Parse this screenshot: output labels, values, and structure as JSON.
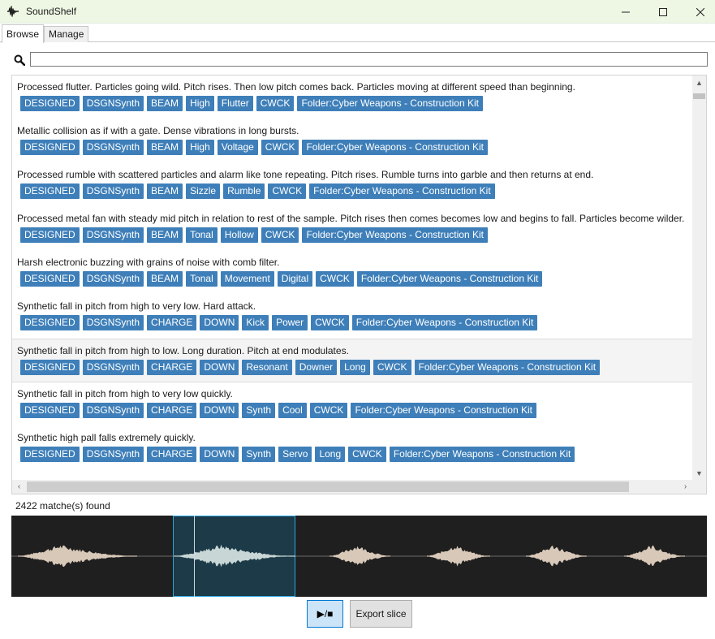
{
  "window": {
    "title": "SoundShelf",
    "icon": "waveform-logo-icon",
    "controls": {
      "minimize": "—",
      "maximize": "☐",
      "close": "✕"
    }
  },
  "tabs": {
    "browse": "Browse",
    "manage": "Manage"
  },
  "search": {
    "value": "",
    "placeholder": "",
    "icon": "magnifier-icon"
  },
  "results": [
    {
      "description": "Processed flutter. Particles going wild. Pitch rises. Then low pitch comes back. Particles moving at different speed than beginning.",
      "tags": [
        "DESIGNED",
        "DSGNSynth",
        "BEAM",
        "High",
        "Flutter",
        "CWCK",
        "Folder:Cyber Weapons - Construction Kit"
      ]
    },
    {
      "description": "Metallic collision as if with a gate. Dense vibrations in long bursts.",
      "tags": [
        "DESIGNED",
        "DSGNSynth",
        "BEAM",
        "High",
        "Voltage",
        "CWCK",
        "Folder:Cyber Weapons - Construction Kit"
      ]
    },
    {
      "description": "Processed rumble with scattered particles and alarm like tone repeating. Pitch rises. Rumble turns into garble and then returns at end.",
      "tags": [
        "DESIGNED",
        "DSGNSynth",
        "BEAM",
        "Sizzle",
        "Rumble",
        "CWCK",
        "Folder:Cyber Weapons - Construction Kit"
      ]
    },
    {
      "description": "Processed metal fan with steady mid pitch in relation to rest of the sample. Pitch rises then comes becomes low and begins to fall. Particles become wilder.",
      "tags": [
        "DESIGNED",
        "DSGNSynth",
        "BEAM",
        "Tonal",
        "Hollow",
        "CWCK",
        "Folder:Cyber Weapons - Construction Kit"
      ]
    },
    {
      "description": "Harsh electronic buzzing with grains of noise with comb filter.",
      "tags": [
        "DESIGNED",
        "DSGNSynth",
        "BEAM",
        "Tonal",
        "Movement",
        "Digital",
        "CWCK",
        "Folder:Cyber Weapons - Construction Kit"
      ]
    },
    {
      "description": "Synthetic fall in pitch from high to very low. Hard attack.",
      "tags": [
        "DESIGNED",
        "DSGNSynth",
        "CHARGE",
        "DOWN",
        "Kick",
        "Power",
        "CWCK",
        "Folder:Cyber Weapons - Construction Kit"
      ]
    },
    {
      "description": "Synthetic fall in pitch from high to low. Long duration. Pitch at end modulates.",
      "tags": [
        "DESIGNED",
        "DSGNSynth",
        "CHARGE",
        "DOWN",
        "Resonant",
        "Downer",
        "Long",
        "CWCK",
        "Folder:Cyber Weapons - Construction Kit"
      ],
      "selected": true
    },
    {
      "description": "Synthetic fall in pitch from high to very low quickly.",
      "tags": [
        "DESIGNED",
        "DSGNSynth",
        "CHARGE",
        "DOWN",
        "Synth",
        "Cool",
        "CWCK",
        "Folder:Cyber Weapons - Construction Kit"
      ]
    },
    {
      "description": "Synthetic high pall falls extremely quickly.",
      "tags": [
        "DESIGNED",
        "DSGNSynth",
        "CHARGE",
        "DOWN",
        "Synth",
        "Servo",
        "Long",
        "CWCK",
        "Folder:Cyber Weapons - Construction Kit"
      ]
    }
  ],
  "status": {
    "matches": "2422 matche(s) found"
  },
  "player": {
    "play_stop_label": "▶/■",
    "export_label": "Export slice"
  },
  "colors": {
    "tag_background": "#3e7fb9",
    "titlebar_background": "#eef7e4",
    "waveform_background": "#1f1f1f",
    "waveform_color": "#d8c8b8",
    "slice_highlight": "#1d3a48",
    "slice_border": "#2aa8e0"
  }
}
